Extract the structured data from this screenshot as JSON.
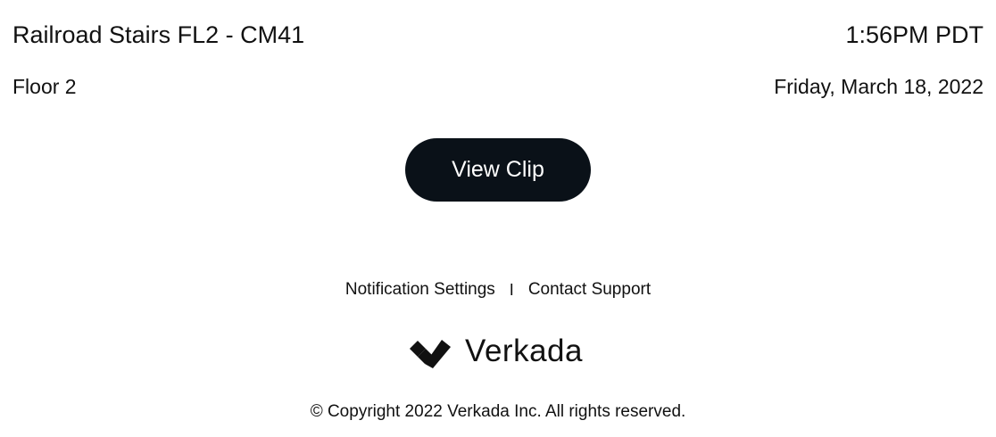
{
  "header": {
    "camera_name": "Railroad Stairs FL2 - CM41",
    "time": "1:56PM PDT",
    "floor": "Floor 2",
    "date": "Friday, March 18, 2022"
  },
  "actions": {
    "view_clip_label": "View Clip"
  },
  "footer": {
    "links": {
      "notification_settings": "Notification Settings",
      "separator": "I",
      "contact_support": "Contact Support"
    },
    "brand": {
      "name": "Verkada",
      "logo_icon": "verkada-logo-icon"
    },
    "copyright": "© Copyright 2022 Verkada Inc. All rights reserved."
  },
  "colors": {
    "button_bg": "#0a1118",
    "button_text": "#ffffff",
    "text": "#111111",
    "background": "#ffffff"
  }
}
